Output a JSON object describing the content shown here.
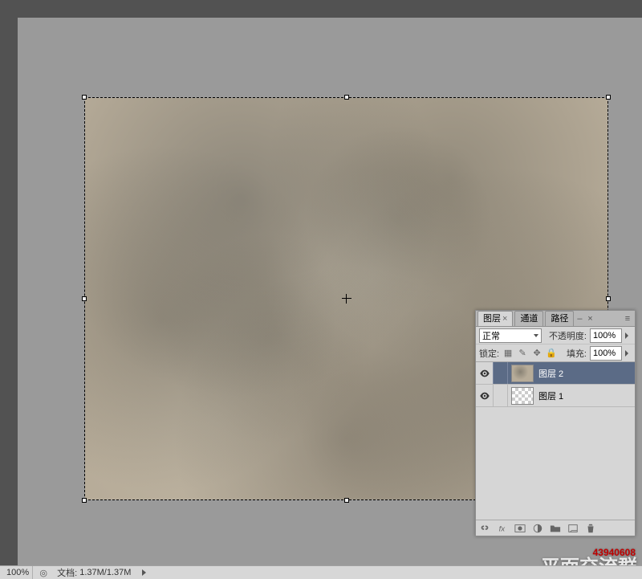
{
  "tabs": {
    "layers": "图层",
    "channels": "通道",
    "paths": "路径"
  },
  "blend": {
    "mode": "正常",
    "opacity_label": "不透明度:",
    "opacity_value": "100%"
  },
  "lock": {
    "label": "锁定:",
    "fill_label": "填充:",
    "fill_value": "100%"
  },
  "layers": [
    {
      "name": "图层 2",
      "visible": true,
      "selected": true,
      "thumb": "texture"
    },
    {
      "name": "图层 1",
      "visible": true,
      "selected": false,
      "thumb": "checker"
    }
  ],
  "status": {
    "zoom": "100%",
    "doc_label": "文档:",
    "doc_value": "1.37M/1.37M"
  },
  "watermark": {
    "id": "43940608",
    "text": "平面交流群"
  }
}
